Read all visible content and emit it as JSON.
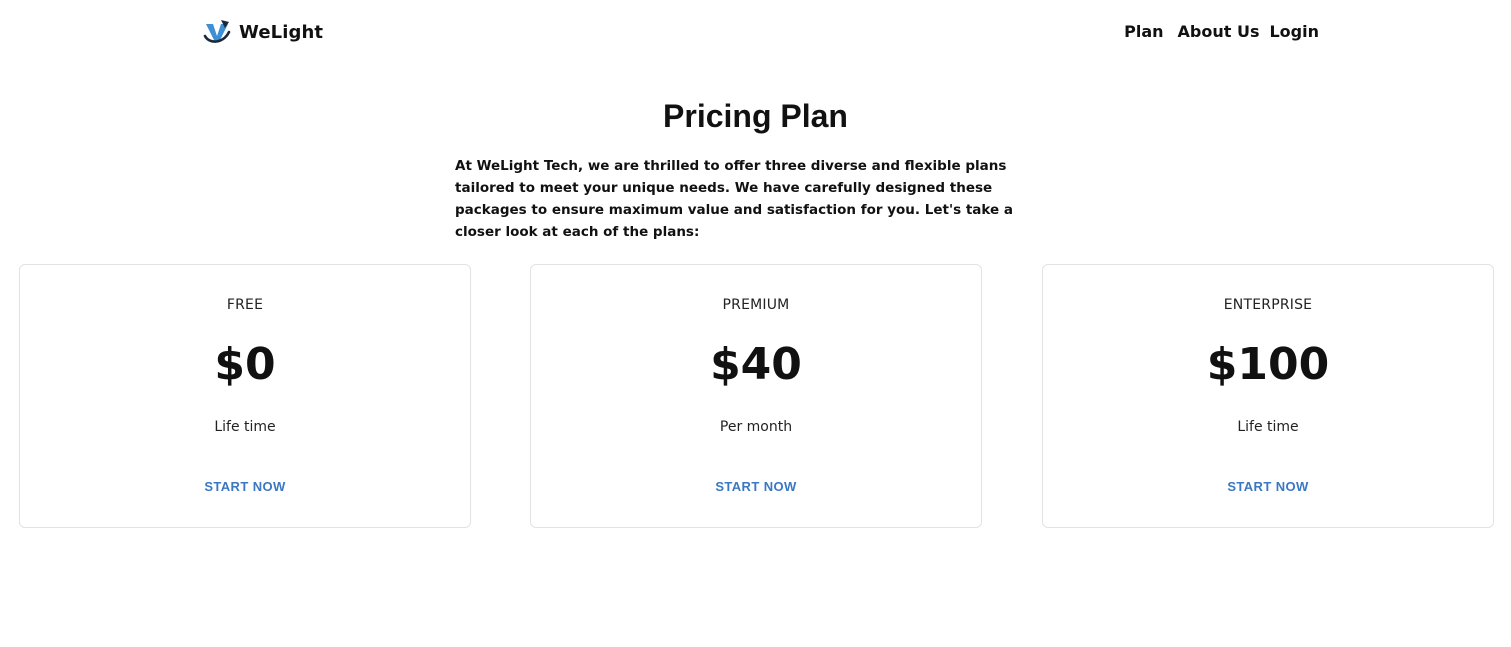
{
  "brand": {
    "name": "WeLight",
    "logo_icon": "welight-logo-icon"
  },
  "nav": {
    "items": [
      {
        "label": "Plan"
      },
      {
        "label": "About Us"
      },
      {
        "label": "Login"
      }
    ]
  },
  "hero": {
    "title": "Pricing Plan",
    "intro": "At WeLight Tech, we are thrilled to offer three diverse and flexible plans tailored to meet your unique needs. We have carefully designed these packages to ensure maximum value and satisfaction for you. Let's take a closer look at each of the plans:"
  },
  "plans": [
    {
      "name": "FREE",
      "price": "$0",
      "period": "Life time",
      "cta": "START NOW"
    },
    {
      "name": "PREMIUM",
      "price": "$40",
      "period": "Per month",
      "cta": "START NOW"
    },
    {
      "name": "ENTERPRISE",
      "price": "$100",
      "period": "Life time",
      "cta": "START NOW"
    }
  ],
  "colors": {
    "accent": "#3b78c2",
    "text": "#111111",
    "card_border": "#e3e3e3"
  }
}
